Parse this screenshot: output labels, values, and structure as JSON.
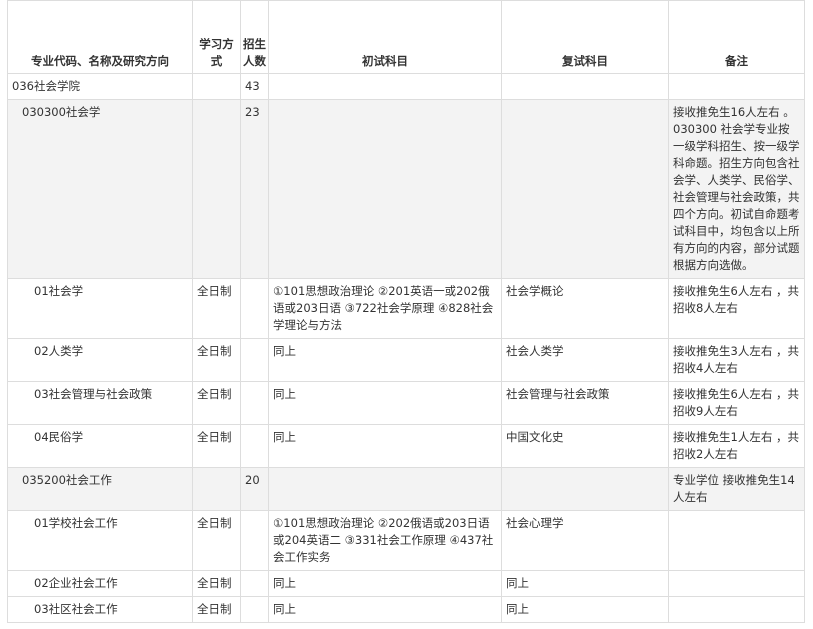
{
  "headers": {
    "major": "专业代码、名称及研究方向",
    "mode": "学习方式",
    "count": "招生人数",
    "prelim": "初试科目",
    "retest": "复试科目",
    "notes": "备注"
  },
  "rows": [
    {
      "level": 0,
      "shaded": false,
      "major": "036社会学院",
      "mode": "",
      "count": "43",
      "prelim": "",
      "retest": "",
      "notes": ""
    },
    {
      "level": 1,
      "shaded": true,
      "major": "030300社会学",
      "mode": "",
      "count": "23",
      "prelim": "",
      "retest": "",
      "notes": "接收推免生16人左右 。030300 社会学专业按一级学科招生、按一级学科命题。招生方向包含社会学、人类学、民俗学、社会管理与社会政策，共四个方向。初试自命题考试科目中，均包含以上所有方向的内容，部分试题根据方向选做。"
    },
    {
      "level": 2,
      "shaded": false,
      "major": "01社会学",
      "mode": "全日制",
      "count": "",
      "prelim": "①101思想政治理论 ②201英语一或202俄语或203日语 ③722社会学原理 ④828社会学理论与方法",
      "retest": "社会学概论",
      "notes": "接收推免生6人左右 ，共招收8人左右"
    },
    {
      "level": 2,
      "shaded": false,
      "major": "02人类学",
      "mode": "全日制",
      "count": "",
      "prelim": "同上",
      "retest": "社会人类学",
      "notes": "接收推免生3人左右 ，共招收4人左右"
    },
    {
      "level": 2,
      "shaded": false,
      "major": "03社会管理与社会政策",
      "mode": "全日制",
      "count": "",
      "prelim": "同上",
      "retest": "社会管理与社会政策",
      "notes": "接收推免生6人左右 ，共招收9人左右"
    },
    {
      "level": 2,
      "shaded": false,
      "major": "04民俗学",
      "mode": "全日制",
      "count": "",
      "prelim": "同上",
      "retest": "中国文化史",
      "notes": "接收推免生1人左右 ，共招收2人左右"
    },
    {
      "level": 1,
      "shaded": true,
      "major": "035200社会工作",
      "mode": "",
      "count": "20",
      "prelim": "",
      "retest": "",
      "notes": "专业学位 接收推免生14人左右"
    },
    {
      "level": 2,
      "shaded": false,
      "major": "01学校社会工作",
      "mode": "全日制",
      "count": "",
      "prelim": "①101思想政治理论 ②202俄语或203日语或204英语二 ③331社会工作原理 ④437社会工作实务",
      "retest": "社会心理学",
      "notes": ""
    },
    {
      "level": 2,
      "shaded": false,
      "major": "02企业社会工作",
      "mode": "全日制",
      "count": "",
      "prelim": "同上",
      "retest": "同上",
      "notes": ""
    },
    {
      "level": 2,
      "shaded": false,
      "major": "03社区社会工作",
      "mode": "全日制",
      "count": "",
      "prelim": "同上",
      "retest": "同上",
      "notes": ""
    }
  ]
}
